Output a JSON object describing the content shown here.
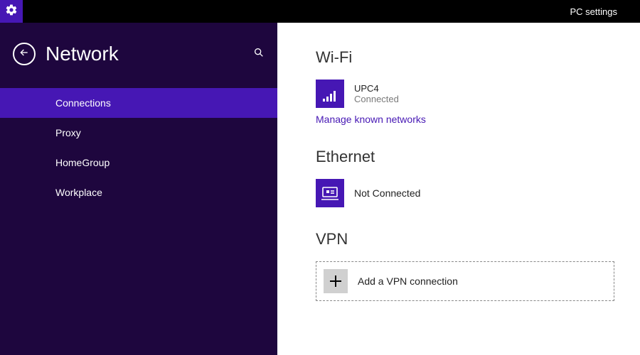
{
  "topbar": {
    "title": "PC settings"
  },
  "sidebar": {
    "title": "Network",
    "items": [
      {
        "label": "Connections",
        "selected": true
      },
      {
        "label": "Proxy",
        "selected": false
      },
      {
        "label": "HomeGroup",
        "selected": false
      },
      {
        "label": "Workplace",
        "selected": false
      }
    ]
  },
  "main": {
    "wifi": {
      "heading": "Wi-Fi",
      "network_name": "UPC4",
      "status": "Connected",
      "manage_link": "Manage known networks"
    },
    "ethernet": {
      "heading": "Ethernet",
      "status": "Not Connected"
    },
    "vpn": {
      "heading": "VPN",
      "add_label": "Add a VPN connection"
    }
  },
  "colors": {
    "accent": "#4617b4",
    "sidebar_bg": "#1e063e",
    "annotation": "#ff0000"
  }
}
